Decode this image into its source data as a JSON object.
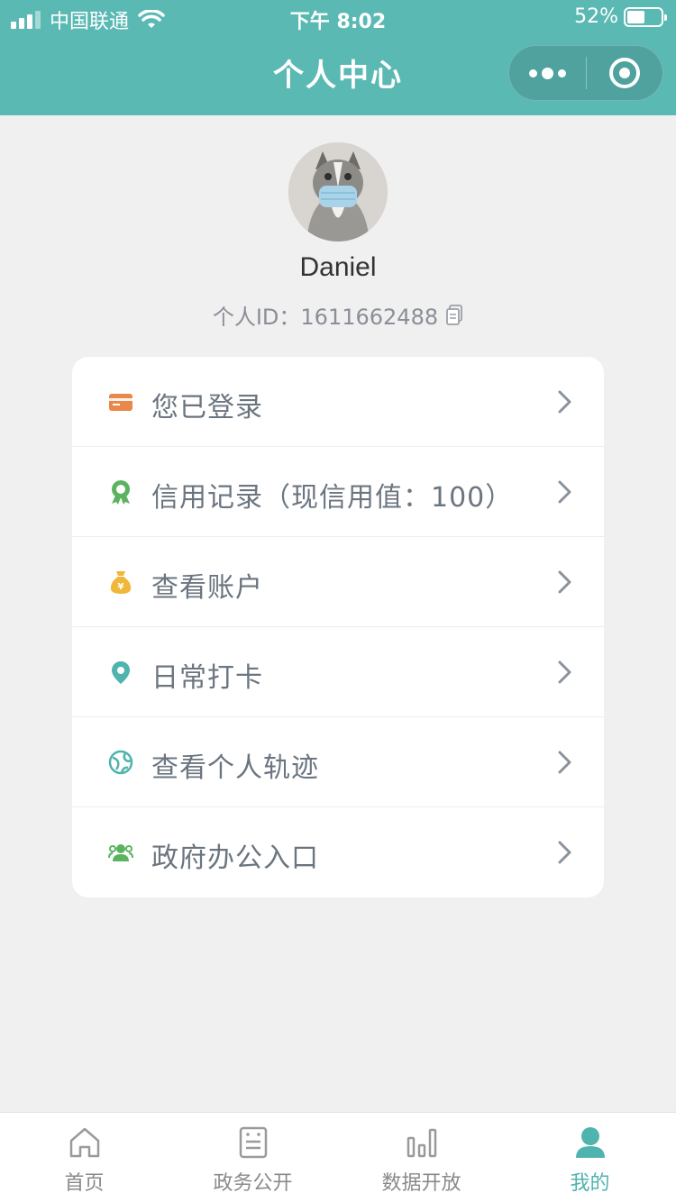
{
  "status_bar": {
    "carrier": "中国联通",
    "time": "下午 8:02",
    "battery": "52%",
    "battery_level": 0.52
  },
  "nav": {
    "title": "个人中心"
  },
  "profile": {
    "name": "Daniel",
    "id_text": "个人ID：1611662488"
  },
  "menu": {
    "items": [
      {
        "label": "您已登录",
        "icon": "card-icon",
        "color": "#e8884a"
      },
      {
        "label": "信用记录（现信用值：100）",
        "icon": "badge-icon",
        "color": "#5bb35e"
      },
      {
        "label": "查看账户",
        "icon": "money-bag-icon",
        "color": "#f0b73a"
      },
      {
        "label": "日常打卡",
        "icon": "location-pin-icon",
        "color": "#4fb3ae"
      },
      {
        "label": "查看个人轨迹",
        "icon": "globe-icon",
        "color": "#4fb3ae"
      },
      {
        "label": "政府办公入口",
        "icon": "group-icon",
        "color": "#5bb35e"
      }
    ]
  },
  "tabbar": {
    "tabs": [
      {
        "label": "首页",
        "icon": "home-icon"
      },
      {
        "label": "政务公开",
        "icon": "document-icon"
      },
      {
        "label": "数据开放",
        "icon": "bar-chart-icon"
      },
      {
        "label": "我的",
        "icon": "user-icon",
        "active": true
      }
    ]
  },
  "colors": {
    "brand": "#5bb9b4",
    "active_tab": "#4fb3ae",
    "background": "#f0f0f0"
  }
}
